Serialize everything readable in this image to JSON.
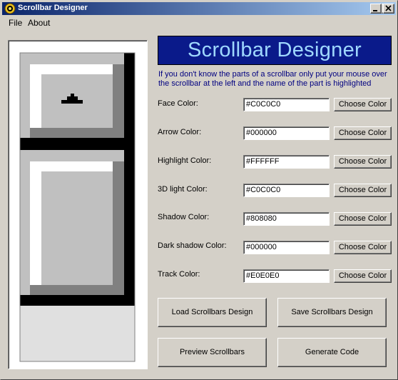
{
  "window": {
    "title": "Scrollbar Designer",
    "controls": {
      "minimize": "minimize-icon",
      "maximize": "maximize-icon",
      "close": "close-icon"
    }
  },
  "menu": {
    "file": "File",
    "about": "About"
  },
  "banner": "Scrollbar Designer",
  "info_text": "If you don't know the parts of a scrollbar only put your mouse over the scrollbar at the left and the name of the part is highlighted",
  "colors": [
    {
      "label": "Face Color:",
      "value": "#C0C0C0",
      "button": "Choose Color"
    },
    {
      "label": "Arrow Color:",
      "value": "#000000",
      "button": "Choose Color"
    },
    {
      "label": "Highlight Color:",
      "value": "#FFFFFF",
      "button": "Choose Color"
    },
    {
      "label": "3D light Color:",
      "value": "#C0C0C0",
      "button": "Choose Color"
    },
    {
      "label": "Shadow Color:",
      "value": "#808080",
      "button": "Choose Color"
    },
    {
      "label": "Dark shadow Color:",
      "value": "#000000",
      "button": "Choose Color"
    },
    {
      "label": "Track Color:",
      "value": "#E0E0E0",
      "button": "Choose Color"
    }
  ],
  "buttons": {
    "load": "Load Scrollbars Design",
    "save": "Save Scrollbars Design",
    "preview": "Preview Scrollbars",
    "generate": "Generate Code"
  }
}
